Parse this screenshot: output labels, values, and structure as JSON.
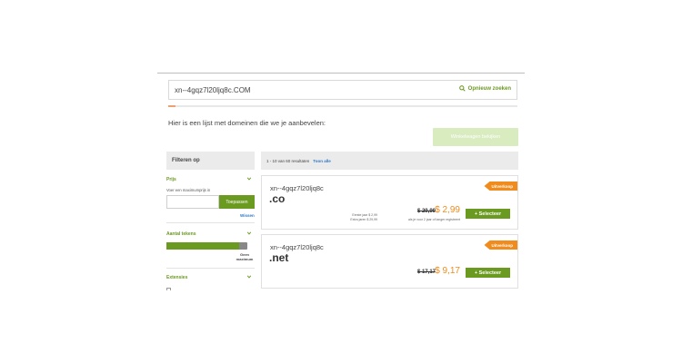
{
  "search": {
    "value": "xn--4gqz7l20ljq8c.COM",
    "button_label": "Opnieuw zoeken"
  },
  "heading": "Hier is een lijst met domeinen die we je aanbevelen:",
  "top_button_label": "Winkelwagen bekijken",
  "filters": {
    "header": "Filteren op",
    "price": {
      "title": "Prijs",
      "max_label": "Voer een maximumprijs in",
      "apply_label": "Toepassen",
      "clear_label": "Wissen"
    },
    "length": {
      "title": "Aantal tekens",
      "slider_fraction": 1.0,
      "max_label": "Geen maximum"
    },
    "extensions": {
      "title": "Extensies"
    }
  },
  "results": {
    "count_text": "1 - 10 van 60 resultaten",
    "show_all": "Toon alle",
    "items": [
      {
        "name": "xn--4gqz7l20ljq8c",
        "tld": ".co",
        "badge": "Uitverkoop",
        "old_price": "$ 29,99",
        "new_price": "$ 2,99",
        "note_left_1": "Eerste jaar $ 2,99",
        "note_left_2": "Extra jaren $ 29,99",
        "note_right": "als je voor 2 jaar of langer registreert",
        "button": "+ Selecteer"
      },
      {
        "name": "xn--4gqz7l20ljq8c",
        "tld": ".net",
        "badge": "Uitverkoop",
        "old_price": "$ 17,17",
        "new_price": "$ 9,17",
        "button": "+ Selecteer"
      }
    ]
  },
  "colors": {
    "accent_green": "#6a9a1f",
    "sale_orange": "#f08c1e",
    "link_blue": "#2c77c8"
  }
}
